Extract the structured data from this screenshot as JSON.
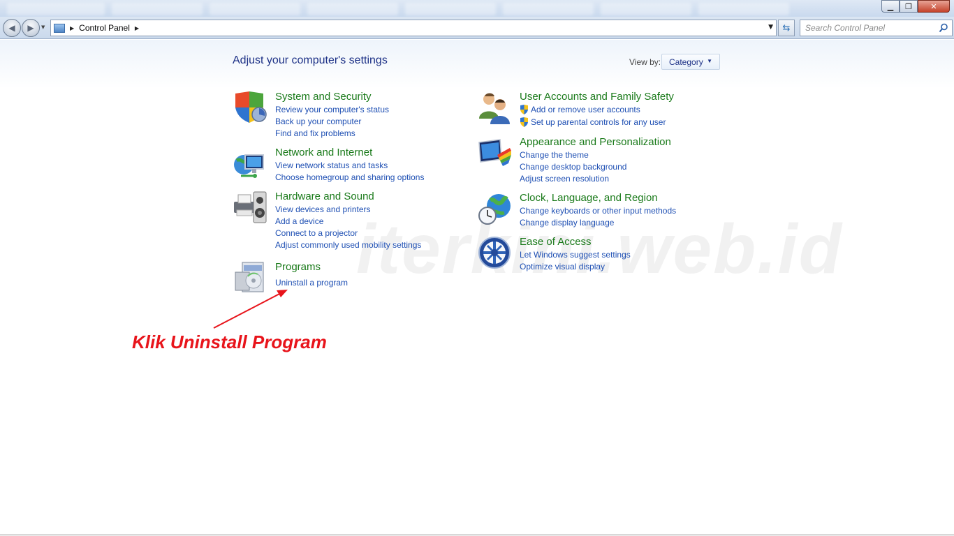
{
  "window": {
    "minimize_glyph": "▁",
    "maximize_glyph": "❐",
    "close_glyph": "✕"
  },
  "navigation": {
    "back_glyph": "◀",
    "forward_glyph": "▶",
    "breadcrumb": [
      "Control Panel"
    ],
    "search_placeholder": "Search Control Panel",
    "refresh_glyph": "⇆"
  },
  "header": {
    "title": "Adjust your computer's settings",
    "view_by_label": "View by:",
    "view_by_value": "Category"
  },
  "categories": {
    "system_security": {
      "title": "System and Security",
      "links": [
        "Review your computer's status",
        "Back up your computer",
        "Find and fix problems"
      ]
    },
    "network_internet": {
      "title": "Network and Internet",
      "links": [
        "View network status and tasks",
        "Choose homegroup and sharing options"
      ]
    },
    "hardware_sound": {
      "title": "Hardware and Sound",
      "links": [
        "View devices and printers",
        "Add a device",
        "Connect to a projector",
        "Adjust commonly used mobility settings"
      ]
    },
    "programs": {
      "title": "Programs",
      "links": [
        "Uninstall a program"
      ]
    },
    "user_accounts": {
      "title": "User Accounts and Family Safety",
      "links": [
        "Add or remove user accounts",
        "Set up parental controls for any user"
      ]
    },
    "appearance": {
      "title": "Appearance and Personalization",
      "links": [
        "Change the theme",
        "Change desktop background",
        "Adjust screen resolution"
      ]
    },
    "clock_language": {
      "title": "Clock, Language, and Region",
      "links": [
        "Change keyboards or other input methods",
        "Change display language"
      ]
    },
    "ease_access": {
      "title": "Ease of Access",
      "links": [
        "Let Windows suggest settings",
        "Optimize visual display"
      ]
    }
  },
  "annotation": {
    "text": "Klik Uninstall Program",
    "color": "#e8141b"
  },
  "watermark": "iterkini.web.id",
  "colors": {
    "category_title": "#1a7a1a",
    "link": "#1e4fb3",
    "heading": "#1e3287"
  }
}
